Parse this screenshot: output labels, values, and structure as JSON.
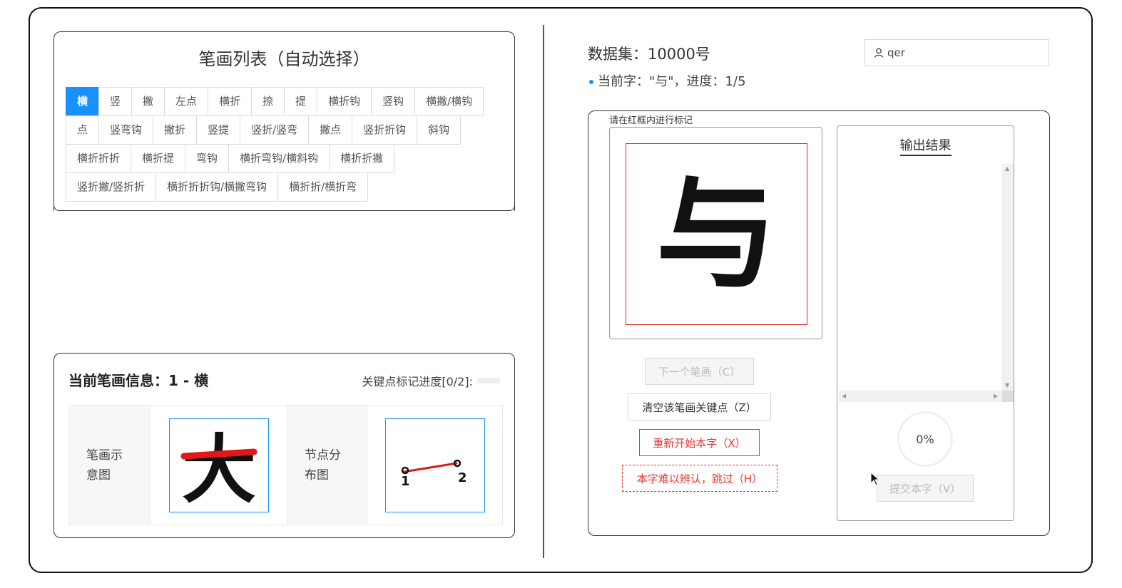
{
  "stroke_list": {
    "title": "笔画列表（自动选择）",
    "rows": [
      [
        "横",
        "竖",
        "撇",
        "左点",
        "横折",
        "捺",
        "提",
        "横折钩",
        "竖钩",
        "横撇/横钩"
      ],
      [
        "点",
        "竖弯钩",
        "撇折",
        "竖提",
        "竖折/竖弯",
        "撇点",
        "竖折折钩",
        "斜钩"
      ],
      [
        "横折折折",
        "横折提",
        "弯钩",
        "横折弯钩/横斜钩",
        "横折折撇"
      ],
      [
        "竖折撇/竖折折",
        "横折折折钩/横撇弯钩",
        "横折折/横折弯"
      ]
    ],
    "active": "横"
  },
  "stroke_info": {
    "title": "当前笔画信息：1 - 横",
    "progress_label": "关键点标记进度[0/2]:",
    "diagram_label": "笔画示意图",
    "diagram_char": "大",
    "node_label": "节点分布图",
    "node_1": "1",
    "node_2": "2"
  },
  "header": {
    "dataset": "数据集：10000号",
    "current": "当前字：\"与\"，进度：1/5",
    "user": "qer"
  },
  "work": {
    "hint": "请在红框内进行标记",
    "char": "与"
  },
  "buttons": {
    "next": "下一个笔画（C）",
    "clear": "清空该笔画关键点（Z）",
    "restart": "重新开始本字（X）",
    "skip": "本字难以辨认，跳过（H）",
    "submit": "提交本字（V）"
  },
  "result": {
    "title": "输出结果",
    "percent": "0%"
  },
  "colors": {
    "accent": "#1890ff",
    "danger": "#e33333",
    "stroke_highlight": "#e01818"
  }
}
